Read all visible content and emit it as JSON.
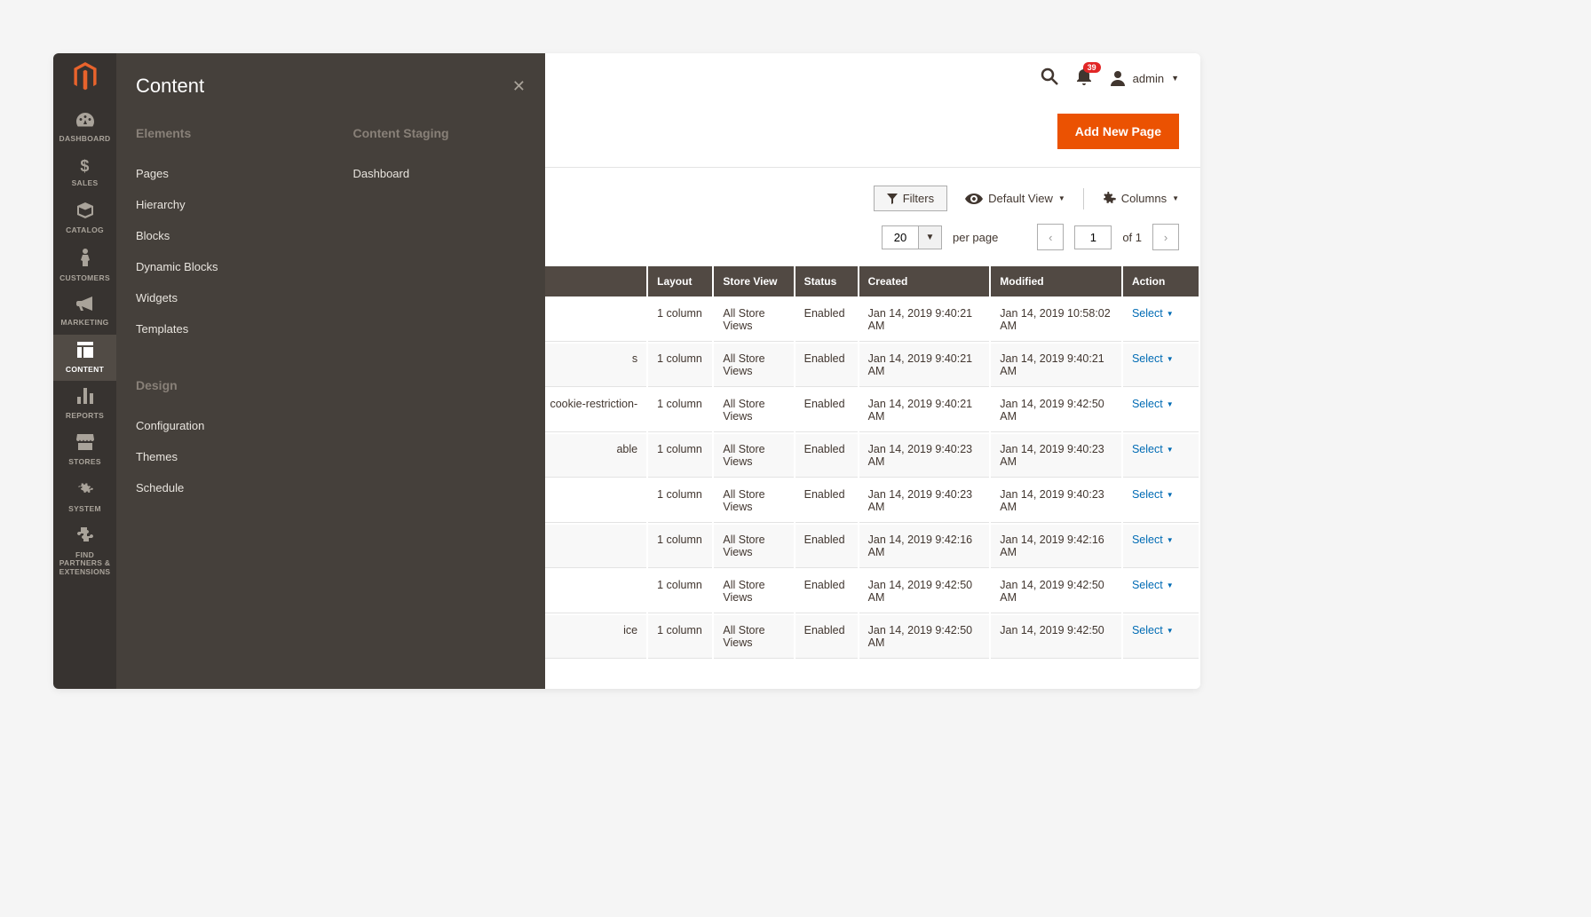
{
  "sidebar": {
    "items": [
      {
        "label": "DASHBOARD"
      },
      {
        "label": "SALES"
      },
      {
        "label": "CATALOG"
      },
      {
        "label": "CUSTOMERS"
      },
      {
        "label": "MARKETING"
      },
      {
        "label": "CONTENT"
      },
      {
        "label": "REPORTS"
      },
      {
        "label": "STORES"
      },
      {
        "label": "SYSTEM"
      },
      {
        "label": "FIND PARTNERS & EXTENSIONS"
      }
    ]
  },
  "submenu": {
    "title": "Content",
    "sections": {
      "elements": {
        "heading": "Elements",
        "items": [
          "Pages",
          "Hierarchy",
          "Blocks",
          "Dynamic Blocks",
          "Widgets",
          "Templates"
        ]
      },
      "design": {
        "heading": "Design",
        "items": [
          "Configuration",
          "Themes",
          "Schedule"
        ]
      },
      "staging": {
        "heading": "Content Staging",
        "items": [
          "Dashboard"
        ]
      }
    }
  },
  "topbar": {
    "notification_count": "39",
    "username": "admin"
  },
  "page": {
    "add_button": "Add New Page"
  },
  "toolbar": {
    "filters": "Filters",
    "default_view": "Default View",
    "columns": "Columns"
  },
  "pager": {
    "page_size": "20",
    "per_page": "per page",
    "current": "1",
    "of_label": "of 1"
  },
  "grid": {
    "headers": {
      "layout": "Layout",
      "store": "Store View",
      "status": "Status",
      "created": "Created",
      "modified": "Modified",
      "action": "Action"
    },
    "rows": [
      {
        "hidden": "",
        "layout": "1 column",
        "store": "All Store Views",
        "status": "Enabled",
        "created": "Jan 14, 2019 9:40:21 AM",
        "modified": "Jan 14, 2019 10:58:02 AM",
        "action": "Select"
      },
      {
        "hidden": "s",
        "layout": "1 column",
        "store": "All Store Views",
        "status": "Enabled",
        "created": "Jan 14, 2019 9:40:21 AM",
        "modified": "Jan 14, 2019 9:40:21 AM",
        "action": "Select"
      },
      {
        "hidden": "cookie-restriction-",
        "layout": "1 column",
        "store": "All Store Views",
        "status": "Enabled",
        "created": "Jan 14, 2019 9:40:21 AM",
        "modified": "Jan 14, 2019 9:42:50 AM",
        "action": "Select"
      },
      {
        "hidden": "able",
        "layout": "1 column",
        "store": "All Store Views",
        "status": "Enabled",
        "created": "Jan 14, 2019 9:40:23 AM",
        "modified": "Jan 14, 2019 9:40:23 AM",
        "action": "Select"
      },
      {
        "hidden": "",
        "layout": "1 column",
        "store": "All Store Views",
        "status": "Enabled",
        "created": "Jan 14, 2019 9:40:23 AM",
        "modified": "Jan 14, 2019 9:40:23 AM",
        "action": "Select"
      },
      {
        "hidden": "",
        "layout": "1 column",
        "store": "All Store Views",
        "status": "Enabled",
        "created": "Jan 14, 2019 9:42:16 AM",
        "modified": "Jan 14, 2019 9:42:16 AM",
        "action": "Select"
      },
      {
        "hidden": "",
        "layout": "1 column",
        "store": "All Store Views",
        "status": "Enabled",
        "created": "Jan 14, 2019 9:42:50 AM",
        "modified": "Jan 14, 2019 9:42:50 AM",
        "action": "Select"
      },
      {
        "hidden": "ice",
        "layout": "1 column",
        "store": "All Store Views",
        "status": "Enabled",
        "created": "Jan 14, 2019 9:42:50 AM",
        "modified": "Jan 14, 2019 9:42:50",
        "action": "Select"
      }
    ]
  }
}
